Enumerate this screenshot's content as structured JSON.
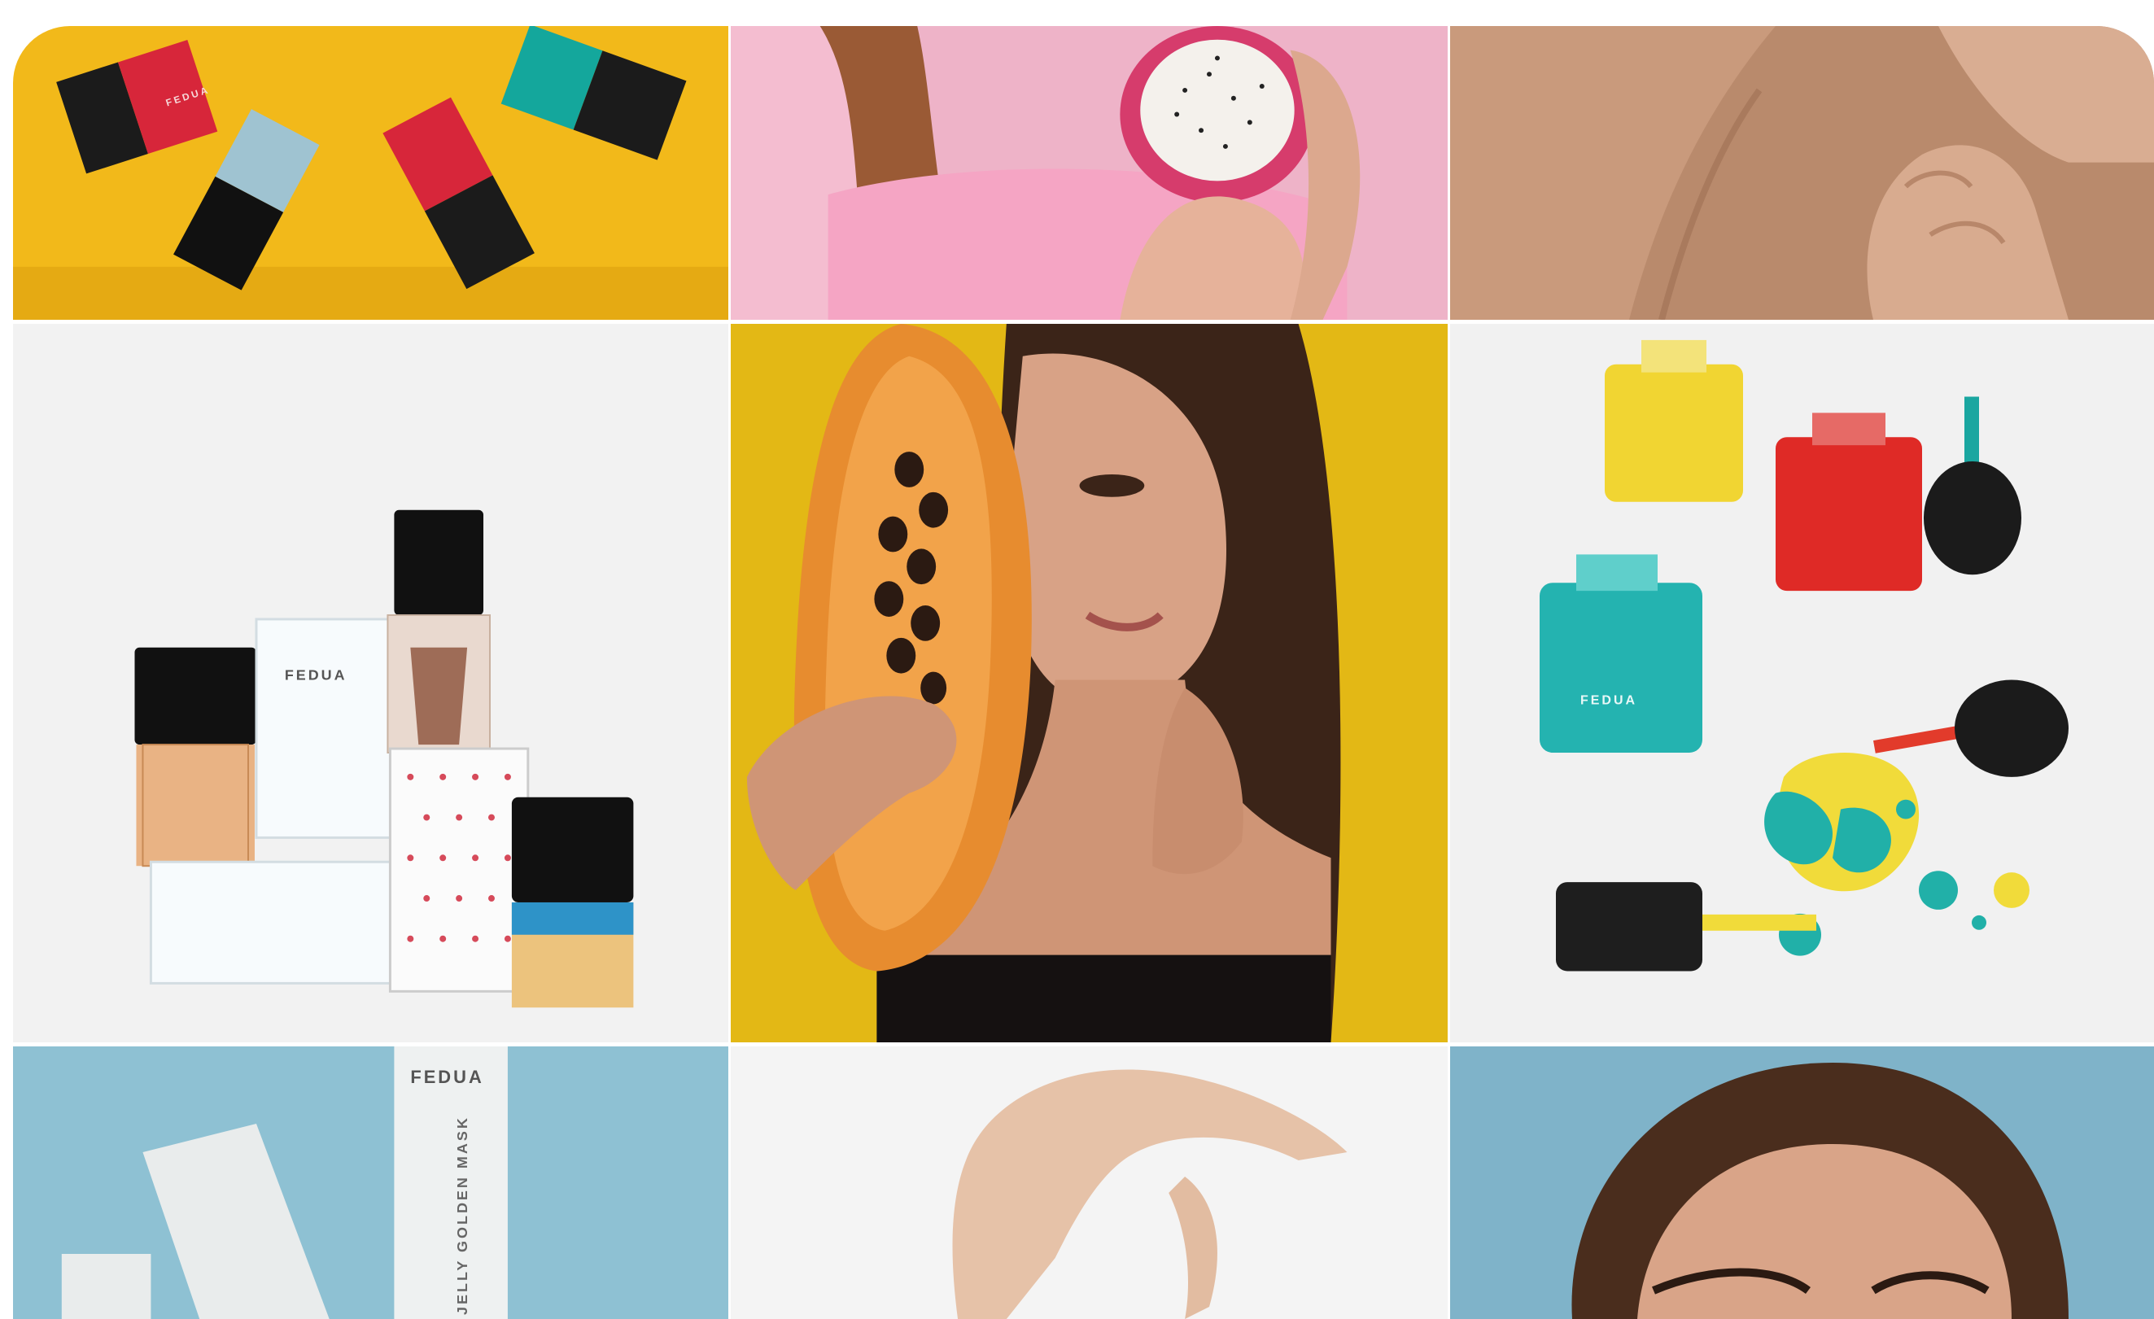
{
  "feed": {
    "posts": [
      {
        "subject": "nail-polish-bottles-on-yellow",
        "brand": "FEDUA"
      },
      {
        "subject": "woman-holding-dragon-fruit"
      },
      {
        "subject": "hands-on-neck-skin"
      },
      {
        "subject": "perfume-and-nail-polish-set",
        "brand": "FEDUA"
      },
      {
        "subject": "woman-with-papaya-on-yellow"
      },
      {
        "subject": "spilled-nail-polish-teal-red-yellow",
        "brand": "FEDUA"
      },
      {
        "subject": "tubes-on-blue-background",
        "brand": "FEDUA",
        "product_text": "JELLY GOLDEN MASK"
      },
      {
        "subject": "hand-gesture-white-background"
      },
      {
        "subject": "woman-portrait-blue-background"
      }
    ]
  },
  "colors": {
    "yellow": "#f2b91a",
    "pink": "#f1a9c6",
    "skin": "#c69a7e",
    "white_bg": "#f2f2f2",
    "mustard": "#e3b815",
    "light_blue": "#8ec1d3"
  }
}
